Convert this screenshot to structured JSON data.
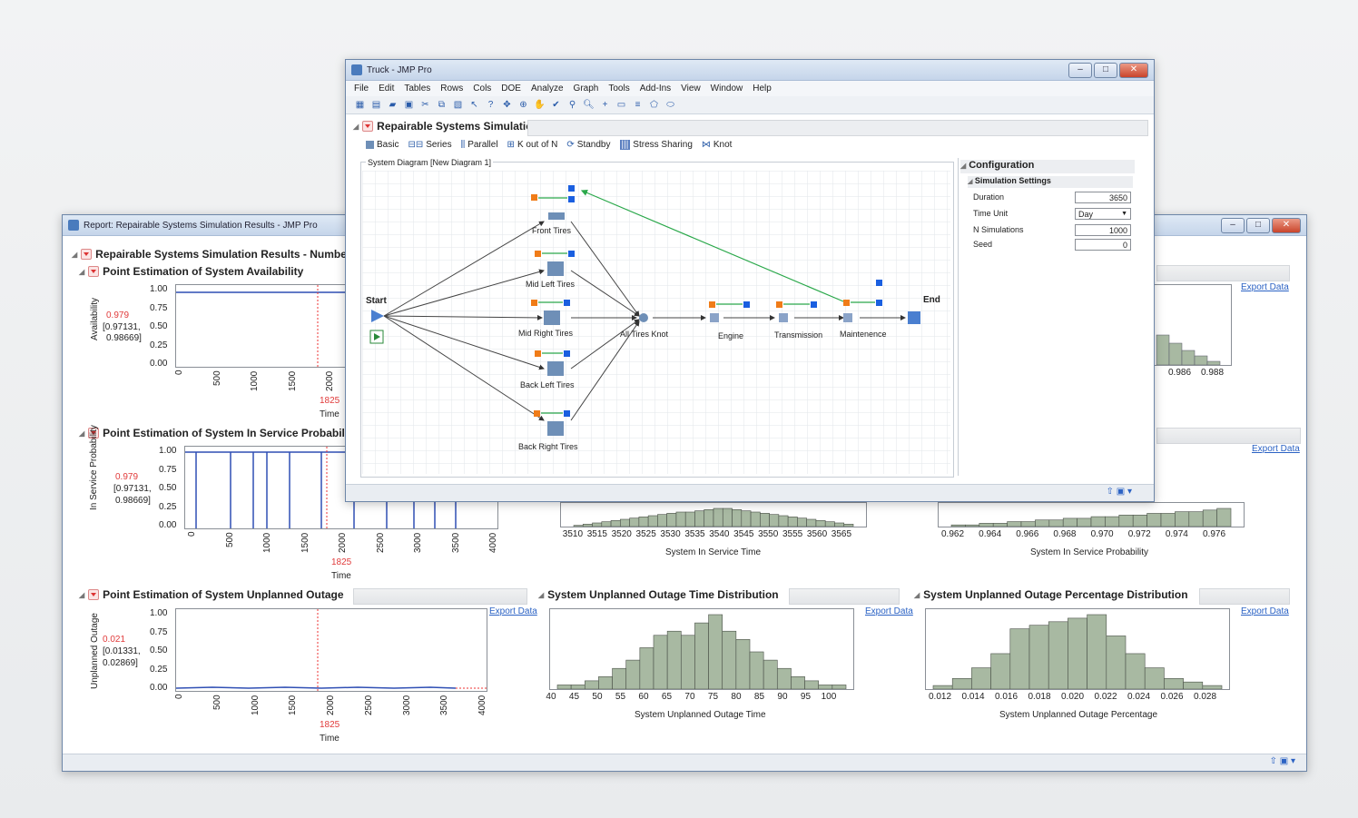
{
  "back_window": {
    "title": "Report: Repairable Systems Simulation Results - JMP Pro",
    "main_heading": "Repairable Systems Simulation Results - Numbe",
    "sections": {
      "availability": {
        "title": "Point Estimation of System Availability",
        "ylabel": "Availability",
        "xlabel": "Time",
        "estimate": "0.979",
        "ci_line1": "[0.97131,",
        "ci_line2": "0.98669]",
        "marker": "1825",
        "yticks": [
          "1.00",
          "0.75",
          "0.50",
          "0.25",
          "0.00"
        ],
        "xticks": [
          "0",
          "500",
          "1000",
          "1500",
          "2000"
        ]
      },
      "in_service": {
        "title": "Point Estimation of System In Service Probabili",
        "ylabel": "In Service Probability",
        "xlabel": "Time",
        "estimate": "0.979",
        "ci_line1": "[0.97131,",
        "ci_line2": "0.98669]",
        "marker": "1825",
        "yticks": [
          "1.00",
          "0.75",
          "0.50",
          "0.25",
          "0.00"
        ],
        "xticks": [
          "0",
          "500",
          "1000",
          "1500",
          "2000",
          "2500",
          "3000",
          "3500",
          "4000"
        ]
      },
      "unplanned": {
        "title": "Point Estimation of System Unplanned Outage",
        "ylabel": "Unplanned Outage",
        "xlabel": "Time",
        "estimate": "0.021",
        "ci_line1": "[0.01331,",
        "ci_line2": "0.02869]",
        "marker": "1825",
        "yticks": [
          "1.00",
          "0.75",
          "0.50",
          "0.25",
          "0.00"
        ],
        "xticks": [
          "0",
          "500",
          "1000",
          "1500",
          "2000",
          "2500",
          "3000",
          "3500",
          "4000"
        ]
      },
      "outage_time": {
        "title": "System Unplanned Outage Time Distribution",
        "xlabel": "System Unplanned Outage Time",
        "xticks": [
          "40",
          "45",
          "50",
          "55",
          "60",
          "65",
          "70",
          "75",
          "80",
          "85",
          "90",
          "95",
          "100"
        ]
      },
      "outage_pct": {
        "title": "System Unplanned Outage Percentage Distribution",
        "xlabel": "System Unplanned Outage Percentage",
        "xticks": [
          "0.012",
          "0.014",
          "0.016",
          "0.018",
          "0.020",
          "0.022",
          "0.024",
          "0.026",
          "0.028"
        ]
      },
      "in_service_time": {
        "xlabel": "System In Service Time",
        "xticks": [
          "3510",
          "3515",
          "3520",
          "3525",
          "3530",
          "3535",
          "3540",
          "3545",
          "3550",
          "3555",
          "3560",
          "3565"
        ]
      },
      "in_service_prob": {
        "xlabel": "System In Service Probability",
        "xticks": [
          "0.962",
          "0.964",
          "0.966",
          "0.968",
          "0.970",
          "0.972",
          "0.974",
          "0.976"
        ]
      },
      "availability_dist": {
        "xticks": [
          "0.986",
          "0.988"
        ]
      }
    },
    "export_label": "Export Data"
  },
  "front_window": {
    "title": "Truck - JMP Pro",
    "menu": [
      "File",
      "Edit",
      "Tables",
      "Rows",
      "Cols",
      "DOE",
      "Analyze",
      "Graph",
      "Tools",
      "Add-Ins",
      "View",
      "Window",
      "Help"
    ],
    "heading": "Repairable Systems Simulation",
    "palette": [
      "Basic",
      "Series",
      "Parallel",
      "K out of N",
      "Standby",
      "Stress Sharing",
      "Knot"
    ],
    "diagram_title": "System Diagram [New Diagram 1]",
    "nodes": {
      "start": "Start",
      "end": "End",
      "front_tires": "Front Tires",
      "mid_left": "Mid Left Tires",
      "mid_right": "Mid Right Tires",
      "back_left": "Back Left Tires",
      "back_right": "Back Right Tires",
      "knot": "All Tires Knot",
      "engine": "Engine",
      "transmission": "Transmission",
      "maintenance": "Maintenence"
    },
    "config": {
      "heading": "Configuration",
      "subheading": "Simulation Settings",
      "duration_label": "Duration",
      "duration_value": "3650",
      "time_unit_label": "Time Unit",
      "time_unit_value": "Day",
      "nsim_label": "N Simulations",
      "nsim_value": "1000",
      "seed_label": "Seed",
      "seed_value": "0"
    }
  },
  "chart_data": [
    {
      "type": "bar",
      "title": "System Unplanned Outage Time Distribution",
      "xlabel": "System Unplanned Outage Time",
      "x_range": [
        40,
        101
      ],
      "values": [
        1,
        1,
        2,
        3,
        5,
        7,
        10,
        13,
        14,
        13,
        16,
        18,
        14,
        12,
        9,
        7,
        5,
        3,
        2,
        1,
        1
      ]
    },
    {
      "type": "bar",
      "title": "System Unplanned Outage Percentage Distribution",
      "xlabel": "System Unplanned Outage Percentage",
      "x_range": [
        0.0115,
        0.0285
      ],
      "values": [
        1,
        3,
        6,
        10,
        17,
        18,
        19,
        20,
        21,
        15,
        10,
        6,
        3,
        2,
        1
      ]
    },
    {
      "type": "bar",
      "xlabel": "System In Service Time",
      "x_range": [
        3505,
        3570
      ],
      "values": [
        1,
        2,
        3,
        4,
        5,
        6,
        7,
        8,
        9,
        10,
        11,
        12,
        12,
        13,
        14,
        15,
        15,
        14,
        13,
        12,
        11,
        10,
        9,
        8,
        7,
        6,
        5,
        4,
        3,
        2
      ]
    },
    {
      "type": "bar",
      "xlabel": "System In Service Probability",
      "x_range": [
        0.961,
        0.977
      ],
      "values": [
        1,
        1,
        2,
        2,
        3,
        3,
        4,
        4,
        5,
        5,
        6,
        6,
        7,
        7,
        8,
        8,
        9,
        9,
        10,
        11
      ]
    }
  ]
}
